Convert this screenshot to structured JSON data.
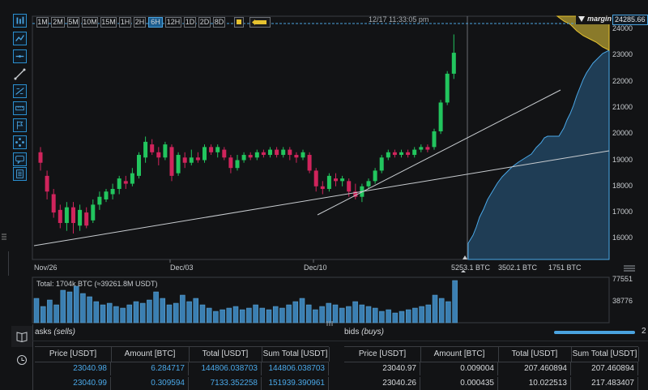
{
  "toolbar": {
    "timeframes": [
      "1M",
      "2M",
      "5M",
      "10M",
      "15M",
      "1H",
      "2H",
      "6H",
      "12H",
      "1D",
      "2D",
      "8D"
    ],
    "active_index": 7
  },
  "crosshair": {
    "time_label": "12/17 11:33:05 pm"
  },
  "margin_badge": {
    "label": "margin",
    "price": "24285.66"
  },
  "y_axis": [
    "24000",
    "23000",
    "22000",
    "21000",
    "20000",
    "19000",
    "18000",
    "17000",
    "16000"
  ],
  "x_axis": [
    "Nov/26",
    "Dec/03",
    "Dec/10"
  ],
  "depth_axis": [
    "5253.1 BTC",
    "3502.1 BTC",
    "1751 BTC"
  ],
  "volume": {
    "total_label": "Total: 1704k BTC (≈39261.8M USDT)",
    "max_label": "77551",
    "mid_label": "38776"
  },
  "asks": {
    "title": "asks",
    "subtitle": "(sells)",
    "columns": [
      "Price [USDT]",
      "Amount [BTC]",
      "Total [USDT]",
      "Sum Total [USDT]"
    ],
    "rows": [
      [
        "23040.98",
        "6.284717",
        "144806.038703",
        "144806.038703"
      ],
      [
        "23040.99",
        "0.309594",
        "7133.352258",
        "151939.390961"
      ]
    ]
  },
  "bids": {
    "title": "bids",
    "subtitle": "(buys)",
    "columns": [
      "Price [USDT]",
      "Amount [BTC]",
      "Total [USDT]",
      "Sum Total [USDT]"
    ],
    "rows": [
      [
        "23040.97",
        "0.009004",
        "207.460894",
        "207.460894"
      ],
      [
        "23040.26",
        "0.000435",
        "10.022513",
        "217.483407"
      ]
    ]
  },
  "slider_value_label": "2",
  "colors": {
    "up": "#22c55e",
    "down": "#d0245c",
    "accent": "#2a8fd0",
    "depth_fill": "#1f3d55",
    "margin_fill": "#8a7a2a"
  }
}
